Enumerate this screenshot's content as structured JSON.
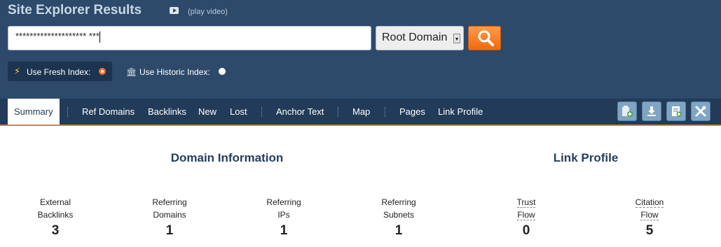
{
  "header": {
    "title": "Site Explorer Results",
    "video_link": "(play video)"
  },
  "search": {
    "value": "******************** ***",
    "scope_selected": "Root Domain",
    "search_icon": "magnifier-icon"
  },
  "index": {
    "fresh_label": "Use Fresh Index:",
    "historic_label": "Use Historic Index:",
    "fresh_selected": true
  },
  "tabs": [
    "Summary",
    "Ref Domains",
    "Backlinks",
    "New",
    "Lost",
    "Anchor Text",
    "Map",
    "Pages",
    "Link Profile"
  ],
  "toolbar_icons": [
    "add-to-bucket-icon",
    "download-icon",
    "report-icon",
    "tools-icon"
  ],
  "sections": {
    "domain_info": "Domain Information",
    "link_profile": "Link Profile"
  },
  "metrics": [
    {
      "line1": "External",
      "line2": "Backlinks",
      "value": "3"
    },
    {
      "line1": "Referring",
      "line2": "Domains",
      "value": "1"
    },
    {
      "line1": "Referring",
      "line2": "IPs",
      "value": "1"
    },
    {
      "line1": "Referring",
      "line2": "Subnets",
      "value": "1"
    },
    {
      "line1": "Trust",
      "line2": "Flow",
      "value": "0"
    },
    {
      "line1": "Citation",
      "line2": "Flow",
      "value": "5"
    }
  ],
  "colors": {
    "header_bg": "#2d4a6b",
    "navbar_bg": "#223b58",
    "accent": "#ef7a22"
  }
}
